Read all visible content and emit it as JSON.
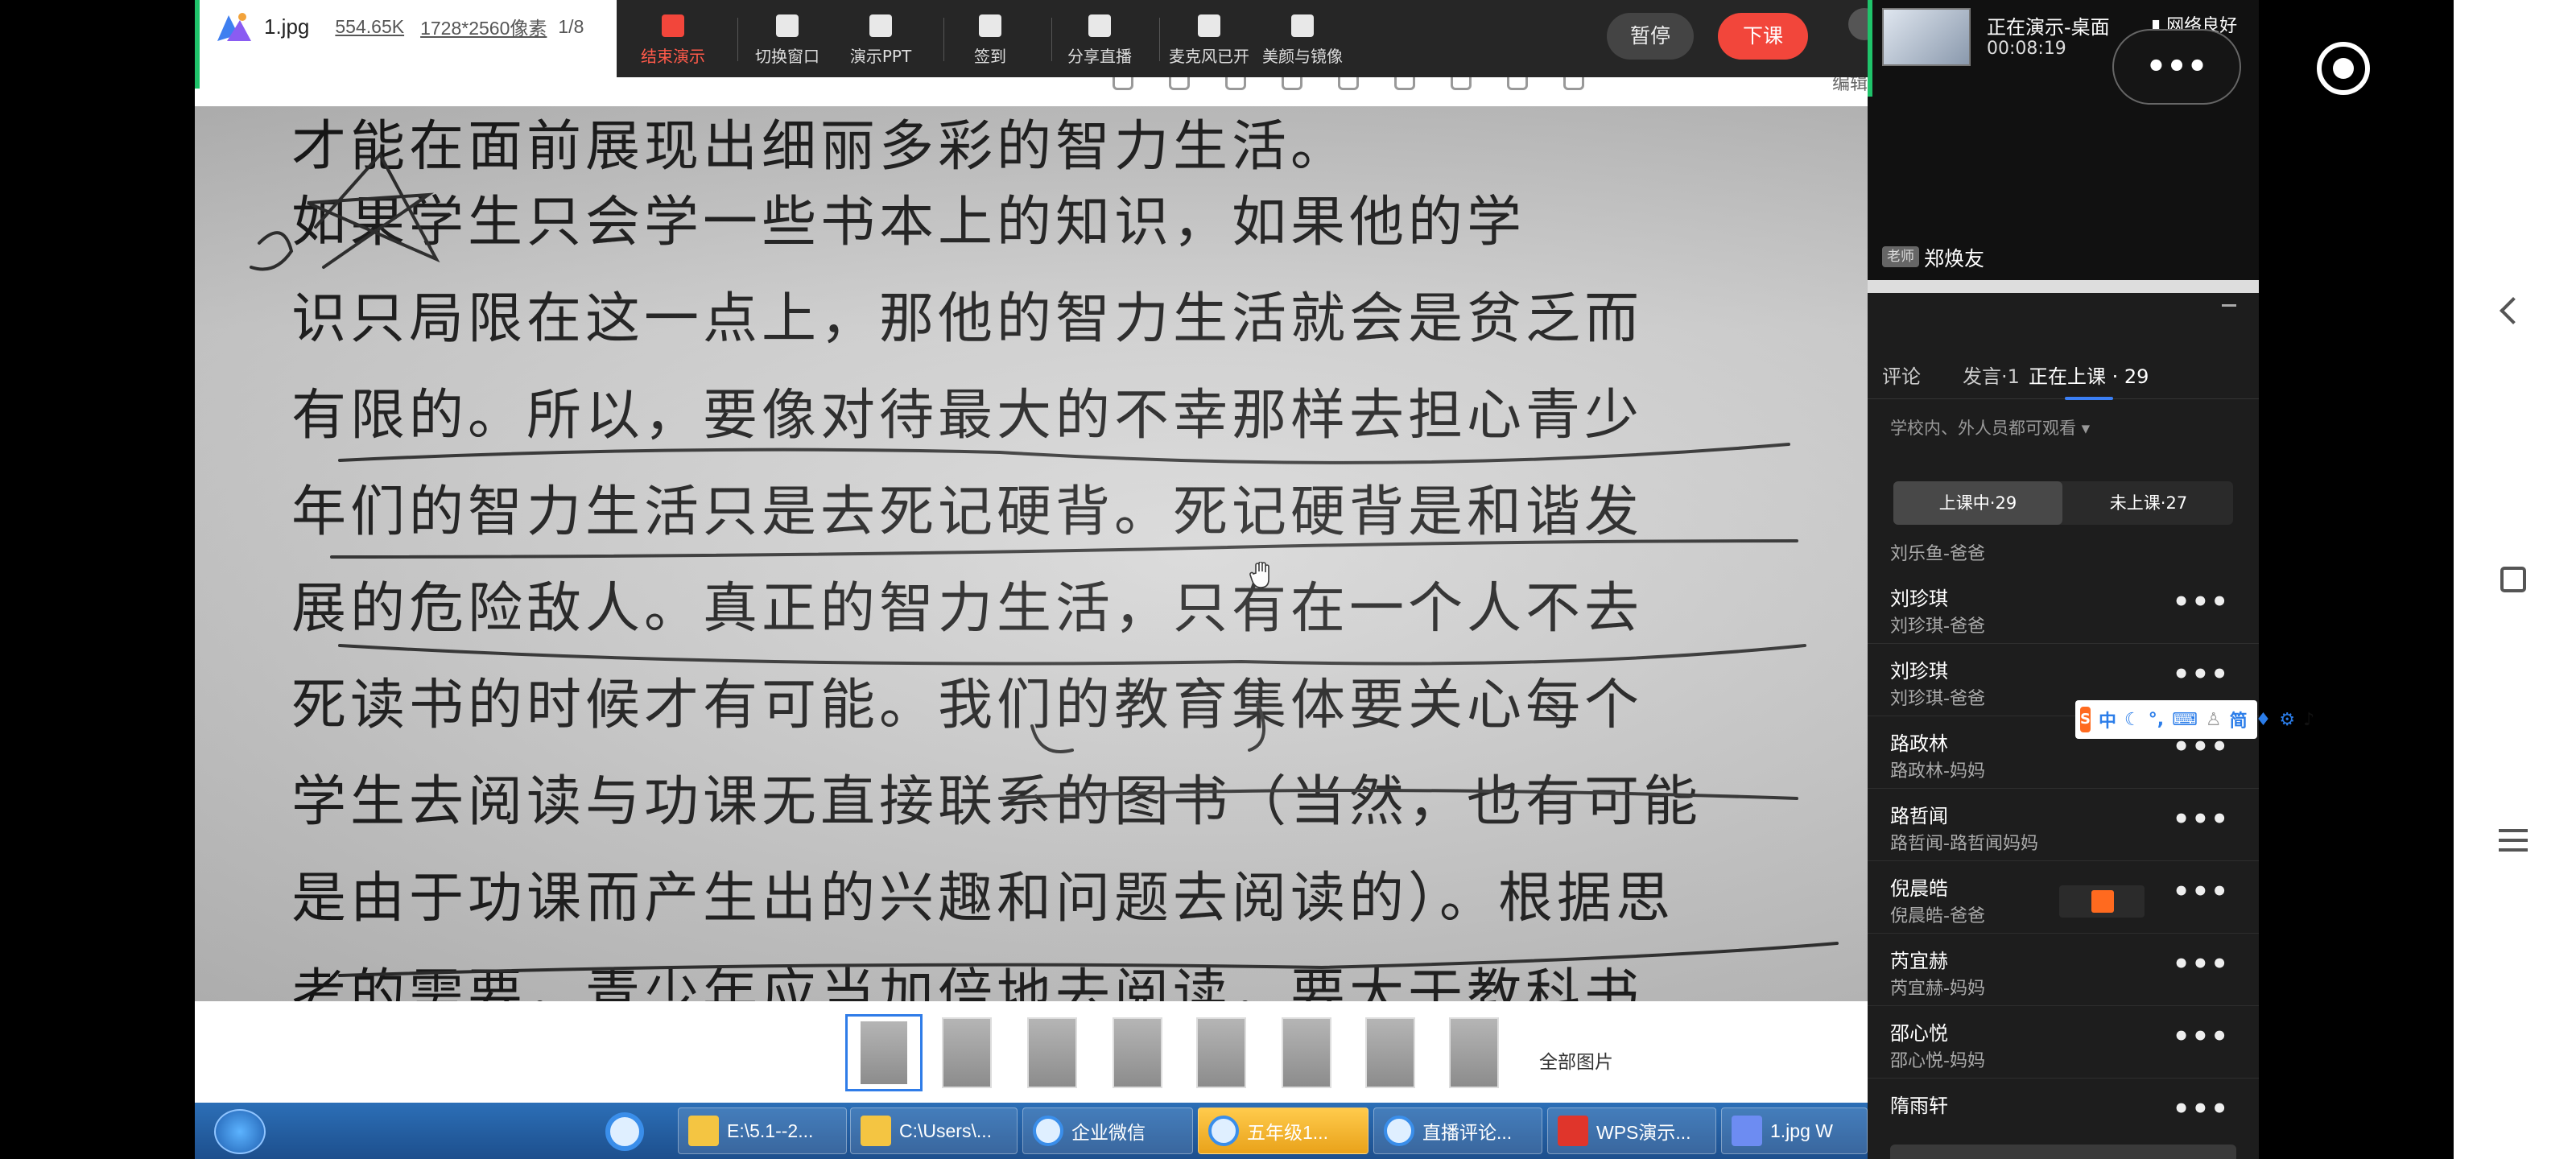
{
  "viewer": {
    "file_name": "1.jpg",
    "file_size": "554.65K",
    "file_dims": "1728*2560像素",
    "page_count": "1/8",
    "edit_label": "编辑",
    "all_images": "全部图片",
    "text_lines": [
      "才能在面前展现出细丽多彩的智力生活。",
      "  如果学生只会学一些书本上的知识，如果他的学",
      "识只局限在这一点上，那他的智力生活就会是贫乏而",
      "有限的。所以，要像对待最大的不幸那样去担心青少",
      "年们的智力生活只是去死记硬背。死记硬背是和谐发",
      "展的危险敌人。真正的智力生活，只有在一个人不去",
      "死读书的时候才有可能。我们的教育集体要关心每个",
      "学生去阅读与功课无直接联系的图书（当然，也有可能",
      "是由于功课而产生出的兴趣和问题去阅读的）。根据思",
      "考的需要，青少年应当加倍地去阅读，要大于教科书"
    ]
  },
  "toolbar": {
    "end_presentation": "结束演示",
    "switch_window": "切换窗口",
    "present_ppt": "演示PPT",
    "sign_in": "签到",
    "share_live": "分享直播",
    "mic_on": "麦克风已开",
    "beauty_mirror": "美颜与镜像",
    "pause": "暂停",
    "end_class": "下课"
  },
  "taskbar": {
    "items": [
      {
        "label": "E:\\5.1--2..."
      },
      {
        "label": "C:\\Users\\..."
      },
      {
        "label": "企业微信"
      },
      {
        "label": "五年级1..."
      },
      {
        "label": "直播评论..."
      },
      {
        "label": "WPS演示..."
      },
      {
        "label": "1.jpg W"
      }
    ]
  },
  "live_panel": {
    "status": "正在演示-桌面",
    "duration": "00:08:19",
    "network": "网络良好",
    "teacher_tag": "老师",
    "teacher_name": "郑焕友",
    "tabs": [
      {
        "label": "评论"
      },
      {
        "label": "发言·1"
      },
      {
        "label": "正在上课 · 29"
      }
    ],
    "visibility": "学校内、外人员都可观看 ▾",
    "seg_in": "上课中·29",
    "seg_out": "未上课·27",
    "first_parent": "刘乐鱼-爸爸",
    "participants": [
      {
        "name": "刘珍琪",
        "parent": "刘珍琪-爸爸"
      },
      {
        "name": "刘珍琪",
        "parent": "刘珍琪-爸爸"
      },
      {
        "name": "路政林",
        "parent": "路政林-妈妈"
      },
      {
        "name": "路哲闻",
        "parent": "路哲闻-路哲闻妈妈"
      },
      {
        "name": "倪晨皓",
        "parent": "倪晨皓-爸爸"
      },
      {
        "name": "芮宜赫",
        "parent": "芮宜赫-妈妈"
      },
      {
        "name": "邵心悦",
        "parent": "邵心悦-妈妈"
      },
      {
        "name": "隋雨轩",
        "parent": ""
      }
    ],
    "more": "•••",
    "ime": {
      "zh": "中",
      "simp": "简"
    }
  },
  "colors": {
    "accent_red": "#f2463b",
    "accent_blue": "#3b7ff5",
    "accent_green": "#1fc36a"
  }
}
